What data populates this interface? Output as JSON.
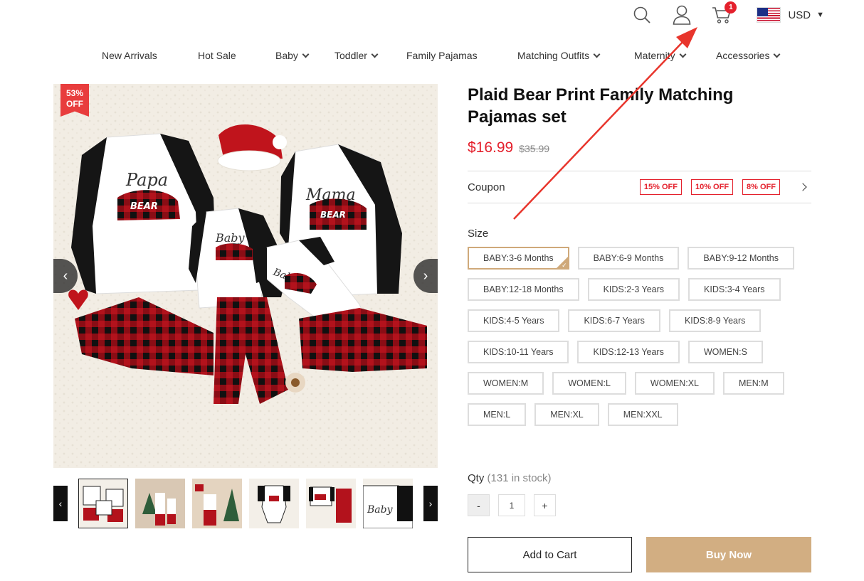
{
  "header": {
    "cart_count": "1",
    "currency": "USD",
    "icons": [
      "search-icon",
      "user-icon",
      "cart-icon",
      "us-flag-icon"
    ]
  },
  "nav": {
    "items": [
      {
        "label": "New Arrivals",
        "dropdown": false
      },
      {
        "label": "Hot Sale",
        "dropdown": false
      },
      {
        "label": "Baby",
        "dropdown": true
      },
      {
        "label": "Toddler",
        "dropdown": true
      },
      {
        "label": "Family Pajamas",
        "dropdown": false
      },
      {
        "label": "Matching Outfits",
        "dropdown": true
      },
      {
        "label": "Maternity",
        "dropdown": true
      },
      {
        "label": "Accessories",
        "dropdown": true
      }
    ]
  },
  "gallery": {
    "discount_percent": "53%",
    "discount_label": "OFF",
    "main_shirt_papa": "Papa",
    "main_shirt_mama": "Mama",
    "main_shirt_baby": "Baby",
    "main_bear_text": "BEAR"
  },
  "product": {
    "title": "Plaid Bear Print Family Matching Pajamas set",
    "price": "$16.99",
    "original_price": "$35.99",
    "coupon_label": "Coupon",
    "coupons": [
      "15% OFF",
      "10% OFF",
      "8% OFF"
    ],
    "size_label": "Size",
    "sizes": [
      "BABY:3-6 Months",
      "BABY:6-9 Months",
      "BABY:9-12 Months",
      "BABY:12-18 Months",
      "KIDS:2-3 Years",
      "KIDS:3-4 Years",
      "KIDS:4-5 Years",
      "KIDS:6-7 Years",
      "KIDS:8-9 Years",
      "KIDS:10-11 Years",
      "KIDS:12-13 Years",
      "WOMEN:S",
      "WOMEN:M",
      "WOMEN:L",
      "WOMEN:XL",
      "MEN:M",
      "MEN:L",
      "MEN:XL",
      "MEN:XXL"
    ],
    "selected_size": "BABY:3-6 Months",
    "qty_label": "Qty",
    "stock_text": "(131 in stock)",
    "qty_value": "1",
    "minus_label": "-",
    "plus_label": "+",
    "add_to_cart": "Add to Cart",
    "buy_now": "Buy Now"
  },
  "colors": {
    "sale_red": "#e4202c",
    "buy_tan": "#d2ae82",
    "annotation_red": "#e8352c"
  }
}
